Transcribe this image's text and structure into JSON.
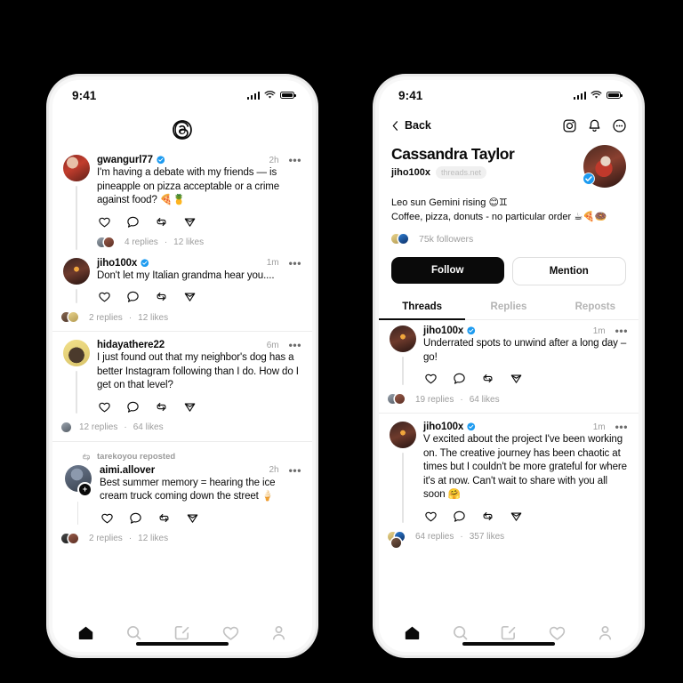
{
  "feed_phone": {
    "status_bar": {
      "time": "9:41",
      "signal_icon": "signal-bars-icon",
      "wifi_icon": "wifi-icon",
      "battery_icon": "battery-full-icon"
    },
    "header": {
      "logo_icon": "threads-logo-icon"
    },
    "posts": [
      {
        "username": "gwangurl77",
        "verified": true,
        "time": "2h",
        "text": "I'm having a debate with my friends — is pineapple on pizza acceptable or a crime against food? 🍕🍍",
        "replies": "4 replies",
        "separator": "·",
        "likes": "12 likes",
        "reposted_by": null
      },
      {
        "username": "jiho100x",
        "verified": true,
        "time": "1m",
        "text": "Don't let my Italian grandma hear you....",
        "replies": "2 replies",
        "separator": "·",
        "likes": "12 likes",
        "reposted_by": null
      },
      {
        "username": "hidayathere22",
        "verified": false,
        "time": "6m",
        "text": "I just found out that my neighbor's dog has a better Instagram following than I do. How do I get on that level?",
        "replies": "12 replies",
        "separator": "·",
        "likes": "64 likes",
        "reposted_by": null
      },
      {
        "username": "aimi.allover",
        "verified": false,
        "time": "2h",
        "text": "Best summer memory = hearing the ice cream truck coming down the street 🍦",
        "replies": "2 replies",
        "separator": "·",
        "likes": "12 likes",
        "reposted_by": "tarekoyou reposted"
      }
    ],
    "post_actions": [
      "like-icon",
      "reply-icon",
      "repost-icon",
      "share-icon"
    ],
    "tabbar": [
      "home-icon",
      "search-icon",
      "compose-icon",
      "activity-icon",
      "profile-icon"
    ]
  },
  "profile_phone": {
    "status_bar": {
      "time": "9:41",
      "signal_icon": "signal-bars-icon",
      "wifi_icon": "wifi-icon",
      "battery_icon": "battery-full-icon"
    },
    "header": {
      "back_label": "Back",
      "icons": [
        "instagram-icon",
        "bell-icon",
        "more-circle-icon"
      ]
    },
    "profile": {
      "display_name": "Cassandra Taylor",
      "handle": "jiho100x",
      "domain_pill": "threads.net",
      "verified": true,
      "bio_line1": "Leo sun Gemini rising 😊♊",
      "bio_line2": "Coffee, pizza, donuts - no particular order ☕🍕🍩",
      "followers": "75k followers"
    },
    "cta": {
      "follow_label": "Follow",
      "mention_label": "Mention"
    },
    "tabs": [
      {
        "label": "Threads",
        "active": true
      },
      {
        "label": "Replies",
        "active": false
      },
      {
        "label": "Reposts",
        "active": false
      }
    ],
    "posts": [
      {
        "username": "jiho100x",
        "verified": true,
        "time": "1m",
        "text": "Underrated spots to unwind after a long day – go!",
        "replies": "19 replies",
        "separator": "·",
        "likes": "64 likes"
      },
      {
        "username": "jiho100x",
        "verified": true,
        "time": "1m",
        "text": "V excited about the project I've been working on. The creative journey has been chaotic at times but I couldn't be more grateful for where it's at now. Can't wait to share with you all soon 🤗",
        "replies": "64 replies",
        "separator": "·",
        "likes": "357 likes"
      }
    ],
    "post_actions": [
      "like-icon",
      "reply-icon",
      "repost-icon",
      "share-icon"
    ],
    "tabbar": [
      "home-icon",
      "search-icon",
      "compose-icon",
      "activity-icon",
      "profile-icon"
    ]
  },
  "colors": {
    "background": "#000000",
    "surface": "#ffffff",
    "accent": "#0a0a0a",
    "verified_blue": "#1d9bf0",
    "muted": "#9d9d9d"
  }
}
